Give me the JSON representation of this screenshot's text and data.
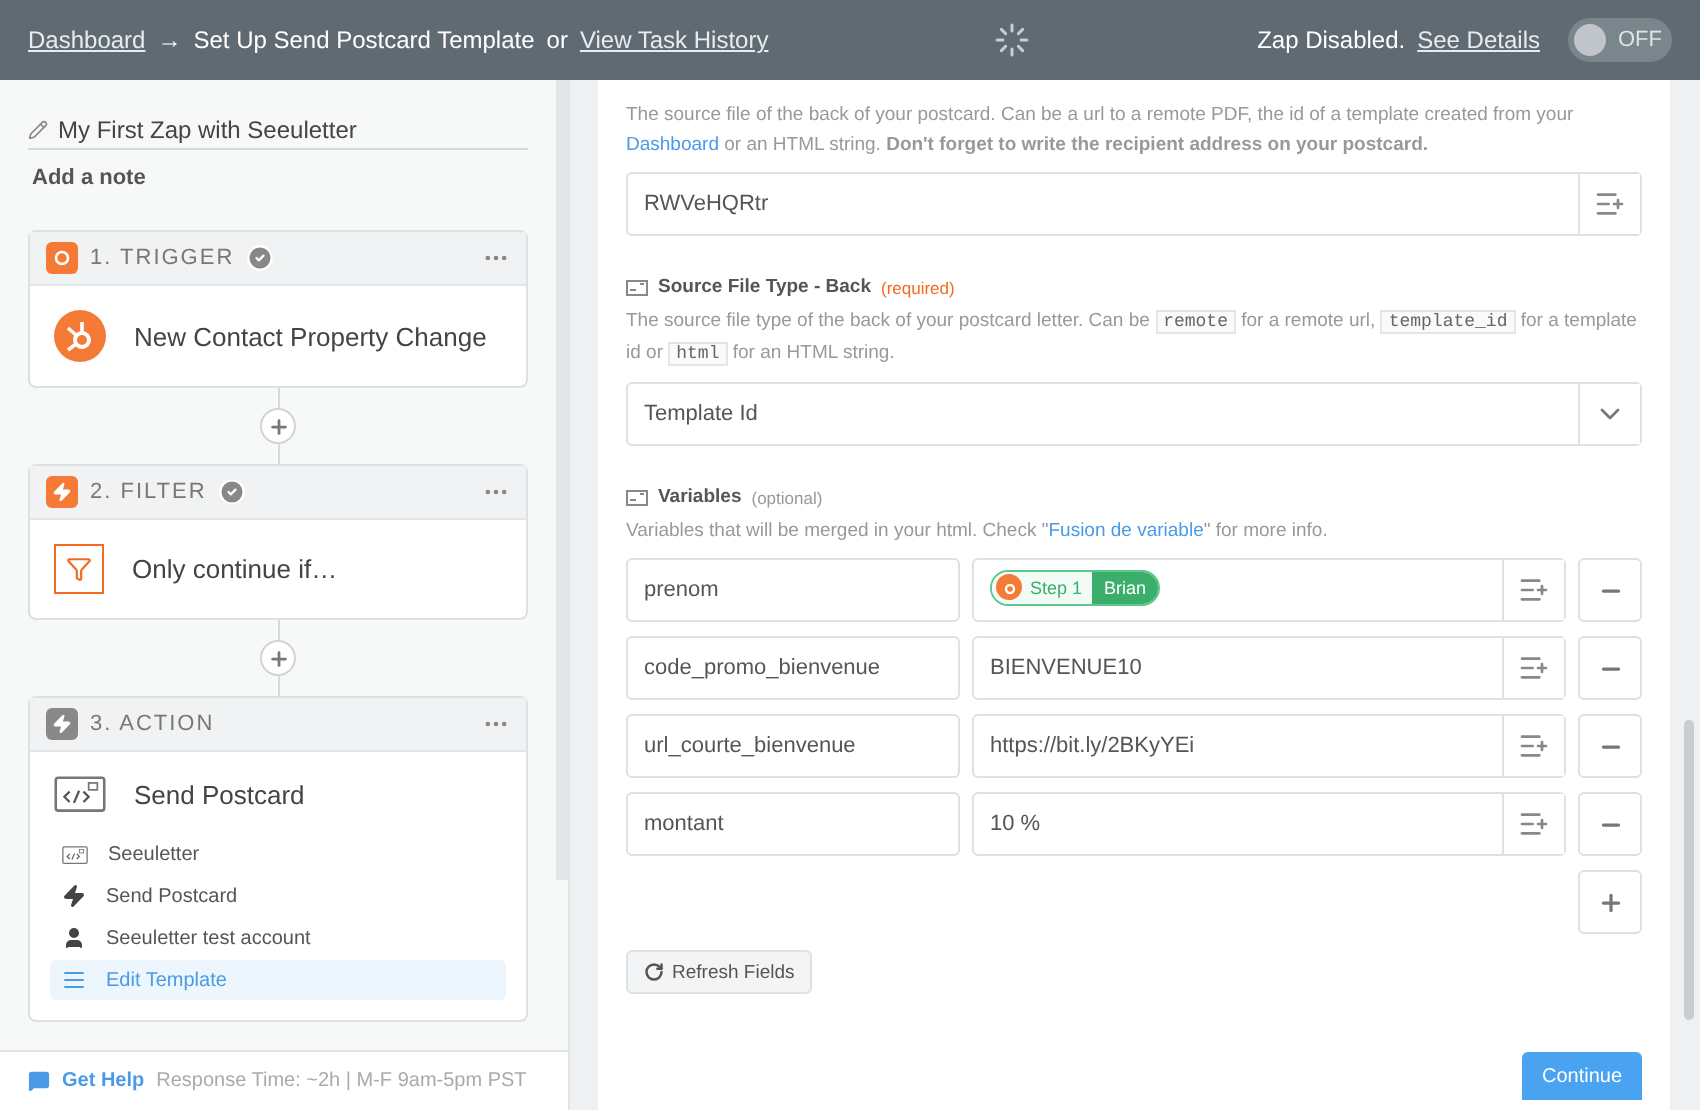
{
  "header": {
    "breadcrumb_link": "Dashboard",
    "arrow": "→",
    "title": "Set Up Send Postcard Template",
    "separator": "or",
    "history_link": "View Task History",
    "status": "Zap Disabled.",
    "details_link": "See Details",
    "toggle": {
      "label": "OFF",
      "on": false
    }
  },
  "sidebar": {
    "zap_name": "My First Zap with Seeuletter",
    "add_note": "Add a note",
    "steps": [
      {
        "kind": "trigger",
        "label": "1. TRIGGER",
        "checked": true,
        "title": "New Contact Property Change"
      },
      {
        "kind": "filter",
        "label": "2. FILTER",
        "checked": true,
        "title": "Only continue if…"
      },
      {
        "kind": "action",
        "label": "3. ACTION",
        "checked": false,
        "title": "Send Postcard",
        "items": [
          {
            "kind": "app",
            "label": "Seeuletter",
            "selected": false
          },
          {
            "kind": "event",
            "label": "Send Postcard",
            "selected": false
          },
          {
            "kind": "account",
            "label": "Seeuletter test account",
            "selected": false
          },
          {
            "kind": "template",
            "label": "Edit Template",
            "selected": true
          }
        ]
      }
    ],
    "help": {
      "link": "Get Help",
      "info": "Response Time: ~2h | M-F 9am-5pm PST"
    }
  },
  "form": {
    "source_file": {
      "description": [
        {
          "kind": "text",
          "text": "The source file of the back of your postcard. Can be a url to a remote PDF, the id of a template created from your "
        },
        {
          "kind": "link",
          "text": "Dashboard"
        },
        {
          "kind": "text",
          "text": " or an HTML string. **Don't forget to write the recipient address on your postcard.**"
        }
      ],
      "value": "RWVeHQRtr"
    },
    "source_type": {
      "label": "Source File Type - Back",
      "tag": "(required)",
      "description": [
        {
          "kind": "text",
          "text": "The source file type of the back of your postcard letter. Can be "
        },
        {
          "kind": "code",
          "text": "remote"
        },
        {
          "kind": "text",
          "text": " for a remote url, "
        },
        {
          "kind": "code",
          "text": "template_id"
        },
        {
          "kind": "text",
          "text": " for a template id or "
        },
        {
          "kind": "code",
          "text": "html"
        },
        {
          "kind": "text",
          "text": " for an HTML string."
        }
      ],
      "value": "Template Id"
    },
    "variables": {
      "label": "Variables",
      "tag": "(optional)",
      "description": [
        {
          "kind": "text",
          "text": "Variables that will be merged in your html. Check \""
        },
        {
          "kind": "link",
          "text": "Fusion de variable"
        },
        {
          "kind": "text",
          "text": "\" for more info."
        }
      ],
      "rows": [
        {
          "key": "prenom",
          "kind": "pill",
          "step": "Step 1",
          "value": "Brian"
        },
        {
          "key": "code_promo_bienvenue",
          "kind": "text",
          "value": "BIENVENUE10"
        },
        {
          "key": "url_courte_bienvenue",
          "kind": "text",
          "value": "https://bit.ly/2BKyYEi"
        },
        {
          "key": "montant",
          "kind": "text",
          "value": "10 %"
        }
      ]
    },
    "refresh_button": "Refresh Fields",
    "continue_button": "Continue"
  }
}
